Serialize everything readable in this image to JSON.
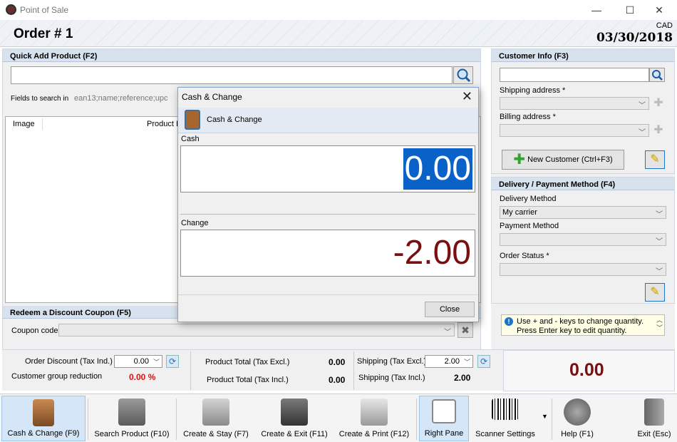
{
  "window": {
    "title": "Point of Sale",
    "minimize": "—",
    "maximize": "☐",
    "close": "✕"
  },
  "header": {
    "order_title": "Order # 1",
    "currency": "CAD",
    "date": "03/30/2018"
  },
  "quick_add": {
    "title": "Quick Add Product (F2)",
    "fields_label": "Fields to search in",
    "fields_value": "ean13;name;reference;upc",
    "columns": [
      "Image",
      "Product In"
    ]
  },
  "coupon": {
    "title": "Redeem a Discount Coupon (F5)",
    "label": "Coupon code",
    "clear": "✖"
  },
  "customer": {
    "title": "Customer Info (F3)",
    "shipping_label": "Shipping address *",
    "billing_label": "Billing address *",
    "new_customer": "New Customer (Ctrl+F3)"
  },
  "delivery": {
    "title": "Delivery / Payment Method (F4)",
    "delivery_label": "Delivery Method",
    "delivery_value": "My carrier",
    "payment_label": "Payment Method",
    "status_label": "Order Status *"
  },
  "tip": {
    "line1": "Use + and - keys to change quantity.",
    "line2": "Press Enter key to edit quantity."
  },
  "totals": {
    "order_discount_label": "Order Discount (Tax Ind.)",
    "order_discount_value": "0.00",
    "group_reduction_label": "Customer group reduction",
    "group_reduction_value": "0.00 %",
    "product_total_excl_label": "Product Total (Tax Excl.)",
    "product_total_excl_value": "0.00",
    "product_total_incl_label": "Product Total (Tax Incl.)",
    "product_total_incl_value": "0.00",
    "shipping_excl_label": "Shipping (Tax Excl.)",
    "shipping_excl_value": "2.00",
    "shipping_incl_label": "Shipping (Tax Incl.)",
    "shipping_incl_value": "2.00",
    "grand_total": "0.00"
  },
  "toolbar": [
    {
      "label": "Cash & Change (F9)",
      "icon": "cash-register-icon"
    },
    {
      "label": "Search Product (F10)",
      "icon": "search-product-icon"
    },
    {
      "label": "Create & Stay (F7)",
      "icon": "create-stay-icon"
    },
    {
      "label": "Create & Exit (F11)",
      "icon": "create-exit-icon"
    },
    {
      "label": "Create & Print (F12)",
      "icon": "printer-icon"
    },
    {
      "label": "Right Pane",
      "icon": "right-pane-icon"
    },
    {
      "label": "Scanner Settings",
      "icon": "barcode-icon"
    },
    {
      "label": "Help (F1)",
      "icon": "help-icon"
    },
    {
      "label": "Exit (Esc)",
      "icon": "exit-door-icon"
    }
  ],
  "dialog": {
    "title": "Cash & Change",
    "band_text": "Cash & Change",
    "cash_label": "Cash",
    "cash_value": "0.00",
    "change_label": "Change",
    "change_value": "-2.00",
    "close_button": "Close",
    "close_x": "✕"
  },
  "colors": {
    "accent": "#0a62c8",
    "negative": "#7b0e0e",
    "discount": "#e01010",
    "panel_header": "#d7e2ee"
  }
}
